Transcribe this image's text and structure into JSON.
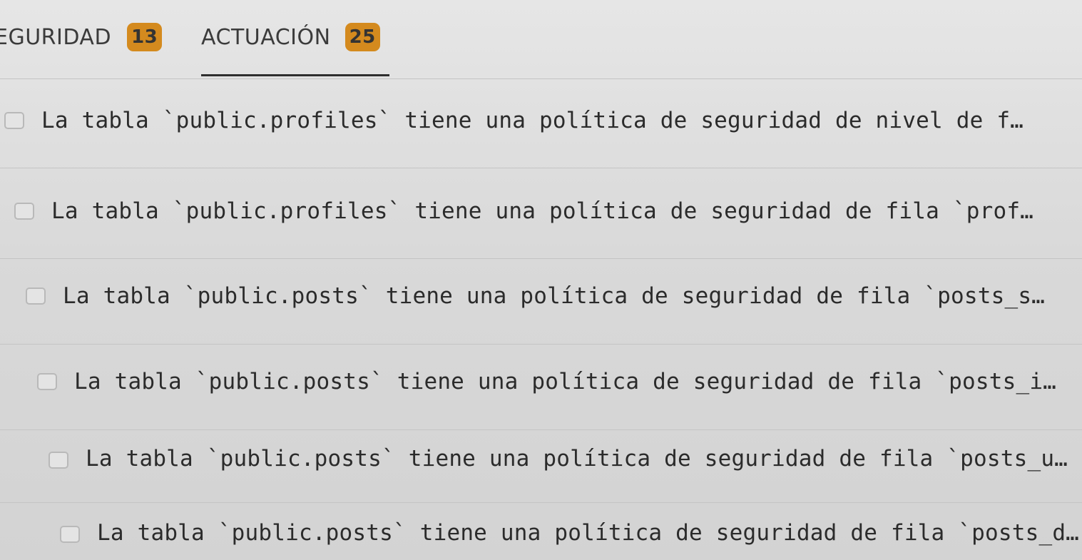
{
  "tabs": [
    {
      "label": "EGURIDAD",
      "count": "13"
    },
    {
      "label": "ACTUACIÓN",
      "count": "25"
    }
  ],
  "active_tab": "ACTUACIÓN",
  "colors": {
    "badge": "#d48a1e",
    "background": "#dcdcdc",
    "text": "#2b2b2b"
  },
  "issues": [
    {
      "text": "La tabla `public.profiles` tiene una política de seguridad de nivel de f…"
    },
    {
      "text": "La tabla `public.profiles` tiene una política de seguridad de fila `prof…"
    },
    {
      "text": "La tabla `public.posts` tiene una política de seguridad de fila `posts_s…"
    },
    {
      "text": "La tabla `public.posts` tiene una política de seguridad de fila `posts_i…"
    },
    {
      "text": "La tabla `public.posts` tiene una política de seguridad de fila `posts_u…"
    },
    {
      "text": "La tabla `public.posts` tiene una política de seguridad de fila `posts_d…"
    }
  ]
}
